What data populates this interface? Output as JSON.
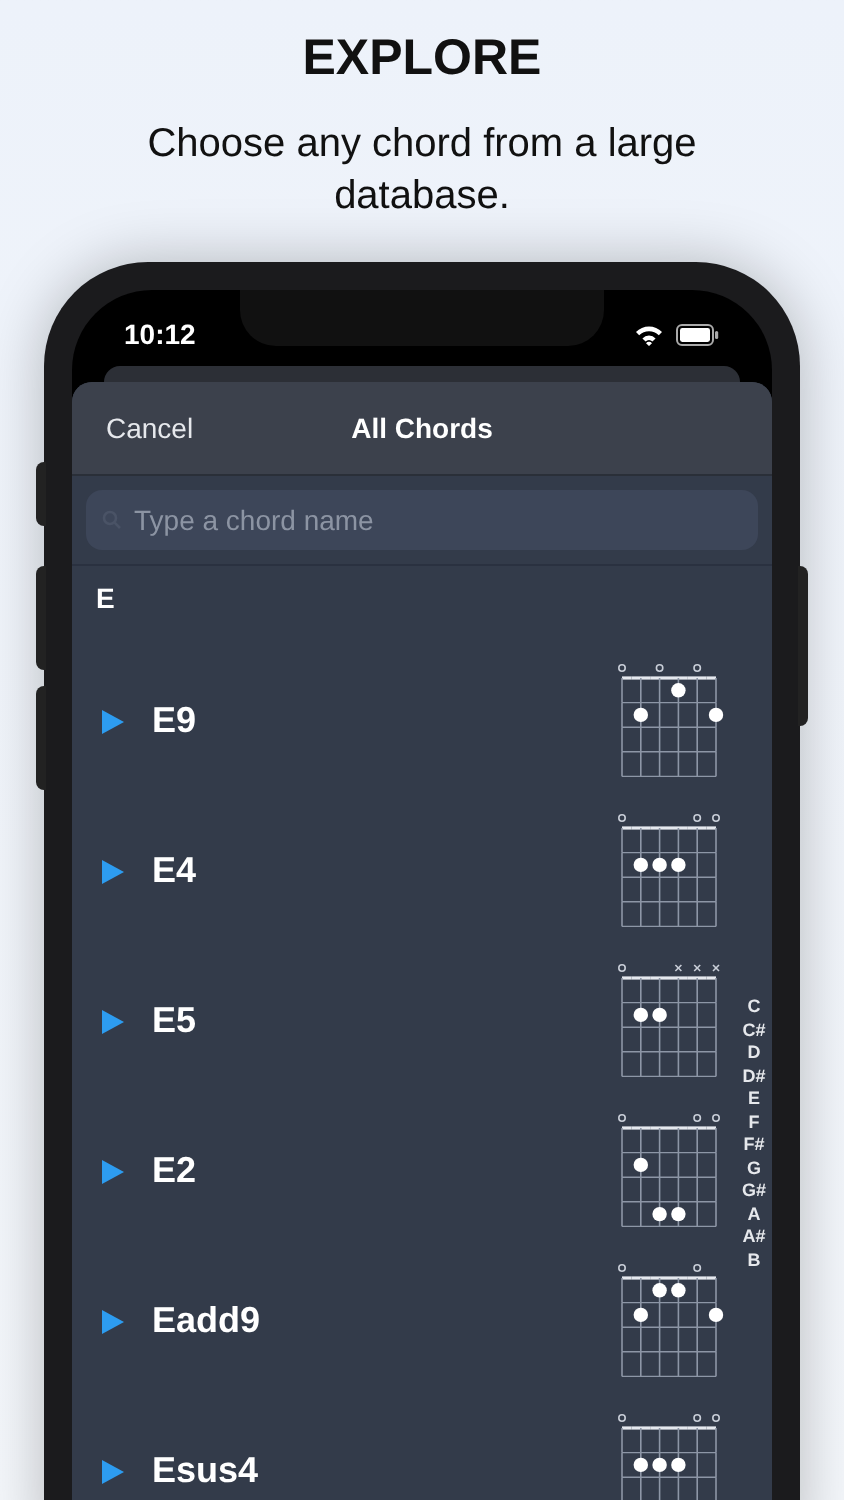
{
  "header": {
    "title": "EXPLORE",
    "subtitle": "Choose any chord from a large database."
  },
  "status_bar": {
    "time": "10:12"
  },
  "sheet": {
    "cancel": "Cancel",
    "title": "All Chords"
  },
  "search": {
    "placeholder": "Type a chord name"
  },
  "section": "E",
  "chords": [
    {
      "name": "E9",
      "strings": [
        {
          "kind": "open",
          "dots": [
            false,
            false,
            false,
            false
          ]
        },
        {
          "kind": "none",
          "dots": [
            false,
            true,
            false,
            false
          ]
        },
        {
          "kind": "open",
          "dots": [
            false,
            false,
            false,
            false
          ]
        },
        {
          "kind": "none",
          "dots": [
            true,
            false,
            false,
            false
          ]
        },
        {
          "kind": "open",
          "dots": [
            false,
            false,
            false,
            false
          ]
        },
        {
          "kind": "none",
          "dots": [
            false,
            true,
            false,
            false
          ]
        }
      ]
    },
    {
      "name": "E4",
      "strings": [
        {
          "kind": "open",
          "dots": [
            false,
            false,
            false,
            false
          ]
        },
        {
          "kind": "none",
          "dots": [
            false,
            true,
            false,
            false
          ]
        },
        {
          "kind": "none",
          "dots": [
            false,
            true,
            false,
            false
          ]
        },
        {
          "kind": "none",
          "dots": [
            false,
            true,
            false,
            false
          ]
        },
        {
          "kind": "open",
          "dots": [
            false,
            false,
            false,
            false
          ]
        },
        {
          "kind": "open",
          "dots": [
            false,
            false,
            false,
            false
          ]
        }
      ]
    },
    {
      "name": "E5",
      "strings": [
        {
          "kind": "open",
          "dots": [
            false,
            false,
            false,
            false
          ]
        },
        {
          "kind": "none",
          "dots": [
            false,
            true,
            false,
            false
          ]
        },
        {
          "kind": "none",
          "dots": [
            false,
            true,
            false,
            false
          ]
        },
        {
          "kind": "muted",
          "dots": [
            false,
            false,
            false,
            false
          ]
        },
        {
          "kind": "muted",
          "dots": [
            false,
            false,
            false,
            false
          ]
        },
        {
          "kind": "muted",
          "dots": [
            false,
            false,
            false,
            false
          ]
        }
      ]
    },
    {
      "name": "E2",
      "strings": [
        {
          "kind": "open",
          "dots": [
            false,
            false,
            false,
            false
          ]
        },
        {
          "kind": "none",
          "dots": [
            false,
            true,
            false,
            false
          ]
        },
        {
          "kind": "none",
          "dots": [
            false,
            false,
            false,
            true
          ]
        },
        {
          "kind": "none",
          "dots": [
            false,
            false,
            false,
            true
          ]
        },
        {
          "kind": "open",
          "dots": [
            false,
            false,
            false,
            false
          ]
        },
        {
          "kind": "open",
          "dots": [
            false,
            false,
            false,
            false
          ]
        }
      ]
    },
    {
      "name": "Eadd9",
      "strings": [
        {
          "kind": "open",
          "dots": [
            false,
            false,
            false,
            false
          ]
        },
        {
          "kind": "none",
          "dots": [
            false,
            true,
            false,
            false
          ]
        },
        {
          "kind": "none",
          "dots": [
            true,
            false,
            false,
            false
          ]
        },
        {
          "kind": "none",
          "dots": [
            true,
            false,
            false,
            false
          ]
        },
        {
          "kind": "open",
          "dots": [
            false,
            false,
            false,
            false
          ]
        },
        {
          "kind": "none",
          "dots": [
            false,
            true,
            false,
            false
          ]
        }
      ]
    },
    {
      "name": "Esus4",
      "strings": [
        {
          "kind": "open",
          "dots": [
            false,
            false,
            false
          ]
        },
        {
          "kind": "none",
          "dots": [
            false,
            true,
            false
          ]
        },
        {
          "kind": "none",
          "dots": [
            false,
            true,
            false
          ]
        },
        {
          "kind": "none",
          "dots": [
            false,
            true,
            false
          ]
        },
        {
          "kind": "open",
          "dots": [
            false,
            false,
            false
          ]
        },
        {
          "kind": "open",
          "dots": [
            false,
            false,
            false
          ]
        }
      ]
    }
  ],
  "index": [
    "C",
    "C#",
    "D",
    "D#",
    "E",
    "F",
    "F#",
    "G",
    "G#",
    "A",
    "A#",
    "B"
  ]
}
